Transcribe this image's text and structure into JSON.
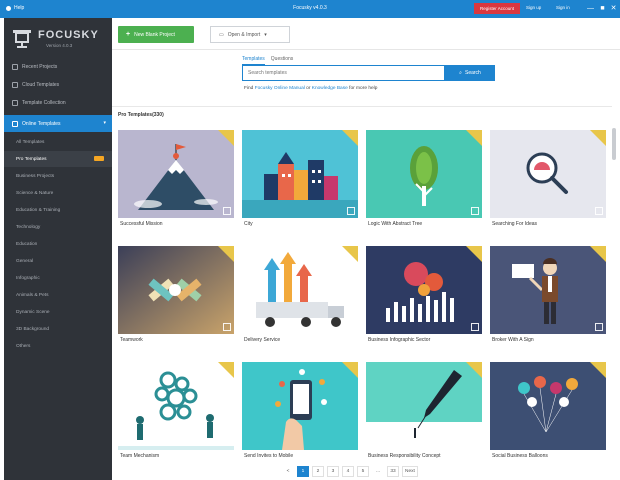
{
  "titlebar": {
    "help_label": "Help",
    "app_title": "Focusky v4.0.3",
    "register_label": "Register Account",
    "signup_label": "Sign up",
    "signin_label": "Sign in",
    "window_buttons": [
      "—",
      "■",
      "✕"
    ]
  },
  "logo": {
    "name": "FOCUSKY",
    "version": "Version 4.0.3"
  },
  "sidebar": {
    "items": [
      {
        "label": "Recent Projects"
      },
      {
        "label": "Cloud Templates"
      },
      {
        "label": "Template Collection"
      },
      {
        "label": "Online Templates"
      }
    ],
    "sub_items": [
      {
        "label": "All Templates"
      },
      {
        "label": "Pro Templates"
      },
      {
        "label": "Business Projects"
      },
      {
        "label": "Science & Nature"
      },
      {
        "label": "Education & Training"
      },
      {
        "label": "Technology"
      },
      {
        "label": "Education"
      },
      {
        "label": "General"
      },
      {
        "label": "Infographic"
      },
      {
        "label": "Animals & Pets"
      },
      {
        "label": "Dynamic Scene"
      },
      {
        "label": "3D Background"
      },
      {
        "label": "Others"
      }
    ]
  },
  "actions": {
    "new_project_label": "New Blank Project",
    "open_import_label": "Open & Import"
  },
  "search": {
    "tabs": [
      "Templates",
      "Questions"
    ],
    "placeholder": "Search templates",
    "button_label": "Search",
    "hint_prefix": "Find",
    "hint_link1": "Focusky Online Manual",
    "hint_mid": "or",
    "hint_link2": "Knowledge Base",
    "hint_suffix": "for more help"
  },
  "section_title": "Pro Templates(330)",
  "templates": [
    {
      "label": "Successful Mission"
    },
    {
      "label": "City"
    },
    {
      "label": "Logic With Abstract Tree"
    },
    {
      "label": "Searching For Ideas"
    },
    {
      "label": "Teamwork"
    },
    {
      "label": "Delivery Service"
    },
    {
      "label": "Business Infographic Sector"
    },
    {
      "label": "Broker With A Sign"
    },
    {
      "label": "Team Mechanism"
    },
    {
      "label": "Send Invites to Mobile"
    },
    {
      "label": "Business Responsibility Concept"
    },
    {
      "label": "Social Business Balloons"
    }
  ],
  "pagination": {
    "items": [
      "<",
      "1",
      "2",
      "3",
      "4",
      "5",
      "...",
      "33",
      "Next"
    ],
    "active": "1"
  },
  "colors": {
    "accent": "#1e84cf",
    "sidebar": "#2f3339",
    "new_button": "#4cb050",
    "register": "#d9373f",
    "pro_badge": "#e8c64a"
  }
}
